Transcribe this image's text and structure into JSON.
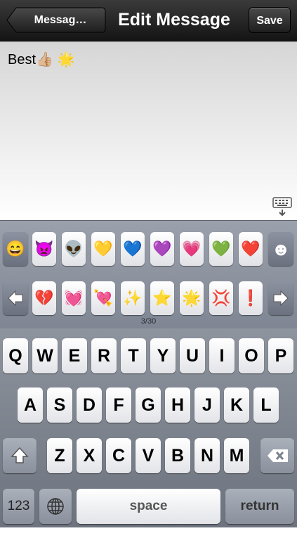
{
  "nav": {
    "back_label": "Messag…",
    "title": "Edit Message",
    "save_label": "Save"
  },
  "message": {
    "text": "Best👍🏼 🌟"
  },
  "emoji_keyboard": {
    "row1": [
      "😄",
      "👿",
      "👽",
      "💛",
      "💙",
      "💜",
      "💗",
      "💚",
      "❤️",
      "☻"
    ],
    "row2": [
      "💔",
      "💓",
      "💘",
      "✨",
      "⭐",
      "🌟",
      "💢",
      "❗"
    ],
    "page_indicator": "3/30"
  },
  "keyboard": {
    "row1": [
      "Q",
      "W",
      "E",
      "R",
      "T",
      "Y",
      "U",
      "I",
      "O",
      "P"
    ],
    "row2": [
      "A",
      "S",
      "D",
      "F",
      "G",
      "H",
      "J",
      "K",
      "L"
    ],
    "row3": [
      "Z",
      "X",
      "C",
      "V",
      "B",
      "N",
      "M"
    ],
    "numbers_label": "123",
    "space_label": "space",
    "return_label": "return"
  }
}
